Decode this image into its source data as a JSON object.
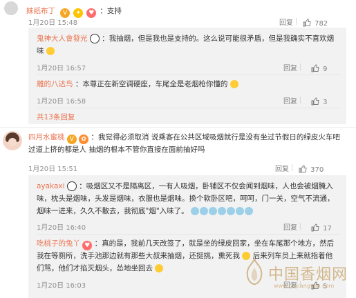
{
  "comments": {
    "c1": {
      "user": "妹纸布丁",
      "badges": [
        "vip-icon",
        "sparkle-icon",
        "heart-icon"
      ],
      "text": "支持",
      "time": "1月20日 15:48",
      "reply_label": "回复",
      "likes": "782"
    },
    "r1": {
      "user": "鬼神大人會發光",
      "text_l1": "我抽烟，但是我也是支持的。这么说可能很矛盾，但是我确实不喜欢烟",
      "text_l2": "味",
      "time": "1月20日 16:57",
      "reply_label": "回复",
      "likes": "9"
    },
    "r2": {
      "user": "雕的八达鸟",
      "text": "本尊正在新空调硬座，车尾全是老烟枪你懂的",
      "time": "1月20日 16:58",
      "reply_label": "回复",
      "likes": "3"
    },
    "more_replies": "共13条回复",
    "c2": {
      "user": "四月水蜜桃",
      "text_l1": "我觉得必须取消 说乘客在公共区域吸烟就行是没有坐过节假日的绿皮火车吧",
      "text_l2": "过道上挤的都是人 抽烟的根本不管你直接在面前抽好吗",
      "time": "1月20日 15:51",
      "reply_label": "回复",
      "likes": "370"
    },
    "r3": {
      "user": "ayakaxi",
      "text_l1": "吸烟区又不是隔离区，一有人吸烟，卧铺区不仅会闻到烟味，人也会被烟腌入",
      "text_l2": "味，枕头是烟味，头发是烟味，衣服也是烟味。换个软卧区吧，呵呵，门一关，空气不流通，",
      "text_l3": "烟味一进来，久久不散去，我彻底\"烟\"入味了。",
      "time": "1月20日 16:40",
      "reply_label": "回复",
      "likes": "17"
    },
    "r4": {
      "user": "吃桃子的兔丫",
      "text_l1": "真的是，我前几天改签了，就是坐的绿皮回家，坐在车尾那个地方，然后",
      "text_l2": "我在等厕所，洗手池那边就有那些大叔来抽烟，还挺挑，熏死我",
      "text_l2b": "后来列车员上来就指着他",
      "text_l3": "们骂，他们才掐灭烟头，怂地坐回去",
      "time": "1月20日 16:03",
      "reply_label": "回复",
      "likes": "5"
    }
  },
  "watermark": {
    "text": "中国香烟网",
    "url": "www.cnxiangyan.com"
  },
  "colors": {
    "name": "#eb7350",
    "subbg": "#f2f2f2",
    "watermark": "#c8a46a"
  }
}
